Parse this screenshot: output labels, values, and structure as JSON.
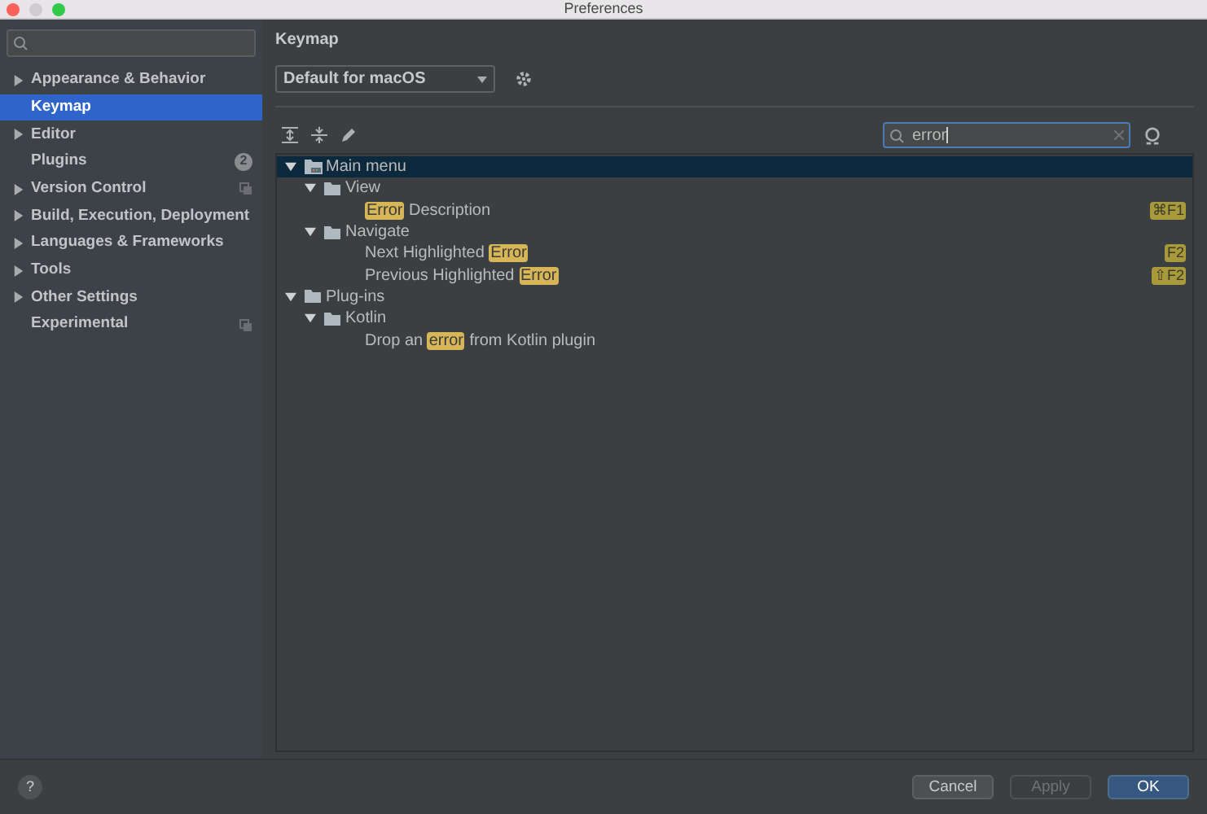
{
  "window": {
    "title": "Preferences"
  },
  "sidebar": {
    "items": [
      {
        "label": "Appearance & Behavior",
        "expandable": true,
        "selected": false
      },
      {
        "label": "Keymap",
        "expandable": false,
        "selected": true
      },
      {
        "label": "Editor",
        "expandable": true,
        "selected": false
      },
      {
        "label": "Plugins",
        "expandable": false,
        "selected": false,
        "badge": "2"
      },
      {
        "label": "Version Control",
        "expandable": true,
        "selected": false,
        "project_level": true
      },
      {
        "label": "Build, Execution, Deployment",
        "expandable": true,
        "selected": false
      },
      {
        "label": "Languages & Frameworks",
        "expandable": true,
        "selected": false
      },
      {
        "label": "Tools",
        "expandable": true,
        "selected": false
      },
      {
        "label": "Other Settings",
        "expandable": true,
        "selected": false
      },
      {
        "label": "Experimental",
        "expandable": false,
        "selected": false,
        "project_level": true
      }
    ]
  },
  "page": {
    "title": "Keymap",
    "keymap_select": "Default for macOS",
    "search": {
      "value": "error"
    },
    "tree": [
      {
        "kind": "menu",
        "expanded": true,
        "selected": true,
        "parts": [
          {
            "text": "Main menu",
            "match": false
          }
        ],
        "children": [
          {
            "kind": "folder",
            "expanded": true,
            "selected": false,
            "parts": [
              {
                "text": "View",
                "match": false
              }
            ],
            "children": [
              {
                "kind": "action",
                "selected": false,
                "parts": [
                  {
                    "text": "Error",
                    "match": true
                  },
                  {
                    "text": " Description",
                    "match": false
                  }
                ],
                "shortcut": "⌘F1"
              }
            ]
          },
          {
            "kind": "folder",
            "expanded": true,
            "selected": false,
            "parts": [
              {
                "text": "Navigate",
                "match": false
              }
            ],
            "children": [
              {
                "kind": "action",
                "selected": false,
                "parts": [
                  {
                    "text": "Next Highlighted ",
                    "match": false
                  },
                  {
                    "text": "Error",
                    "match": true
                  }
                ],
                "shortcut": "F2"
              },
              {
                "kind": "action",
                "selected": false,
                "parts": [
                  {
                    "text": "Previous Highlighted ",
                    "match": false
                  },
                  {
                    "text": "Error",
                    "match": true
                  }
                ],
                "shortcut": "⇧F2"
              }
            ]
          }
        ]
      },
      {
        "kind": "folder",
        "expanded": true,
        "selected": false,
        "parts": [
          {
            "text": "Plug-ins",
            "match": false
          }
        ],
        "children": [
          {
            "kind": "folder",
            "expanded": true,
            "selected": false,
            "parts": [
              {
                "text": "Kotlin",
                "match": false
              }
            ],
            "children": [
              {
                "kind": "action",
                "selected": false,
                "parts": [
                  {
                    "text": "Drop an ",
                    "match": false
                  },
                  {
                    "text": "error",
                    "match": true
                  },
                  {
                    "text": " from Kotlin plugin",
                    "match": false
                  }
                ]
              }
            ]
          }
        ]
      }
    ]
  },
  "footer": {
    "help": "?",
    "buttons": [
      {
        "label": "Cancel",
        "kind": "normal",
        "disabled": false
      },
      {
        "label": "Apply",
        "kind": "normal",
        "disabled": true
      },
      {
        "label": "OK",
        "kind": "default",
        "disabled": false
      }
    ]
  }
}
